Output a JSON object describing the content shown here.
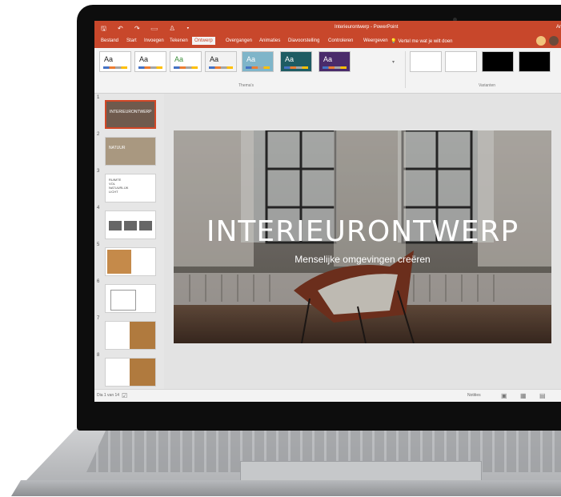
{
  "window": {
    "title": "Interieurontwerp - PowerPoint",
    "title_right": "Ar",
    "quick_access": "🖫 ↶ ↷ ▭ ♙ ▾"
  },
  "tabs": [
    {
      "label": "Bestand",
      "active": false
    },
    {
      "label": "Start",
      "active": false
    },
    {
      "label": "Invoegen",
      "active": false
    },
    {
      "label": "Tekenen",
      "active": false
    },
    {
      "label": "Ontwerp",
      "active": true
    },
    {
      "label": "Overgangen",
      "active": false
    },
    {
      "label": "Animaties",
      "active": false
    },
    {
      "label": "Diavoorstelling",
      "active": false
    },
    {
      "label": "Controleren",
      "active": false
    },
    {
      "label": "Weergeven",
      "active": false
    }
  ],
  "tell_me": {
    "text": "Vertel me wat je wilt doen",
    "icon": "lightbulb-icon"
  },
  "ribbon": {
    "themes": [
      {
        "label": "Aa",
        "bg": "#ffffff",
        "fg": "#222222"
      },
      {
        "label": "Aa",
        "bg": "#ffffff",
        "fg": "#222222"
      },
      {
        "label": "Aa",
        "bg": "#ffffff",
        "fg": "#3d8f3d"
      },
      {
        "label": "Aa",
        "bg": "#f2f2f2",
        "fg": "#222222"
      },
      {
        "label": "Aa",
        "bg": "#7fb5c9",
        "fg": "#ffffff"
      },
      {
        "label": "Aa",
        "bg": "#1f5c63",
        "fg": "#ffffff"
      },
      {
        "label": "Aa",
        "bg": "#4a2b6b",
        "fg": "#ffffff"
      }
    ],
    "themes_group_label": "Thema's",
    "variants": [
      {
        "bg": "#ffffff"
      },
      {
        "bg": "#ffffff"
      },
      {
        "bg": "#000000"
      },
      {
        "bg": "#000000"
      }
    ],
    "variants_group_label": "Varianten"
  },
  "slides": [
    {
      "num": "1",
      "text": "INTERIEURONTWERP",
      "bg": "#6f5a4d",
      "selected": true
    },
    {
      "num": "2",
      "text": "NATUUR",
      "bg": "#a99880",
      "selected": false
    },
    {
      "num": "3",
      "text": "RUIMTE VOL NATUURLIJK LICHT",
      "bg": "#ffffff",
      "selected": false
    },
    {
      "num": "4",
      "text": "",
      "bg": "#ffffff",
      "selected": false
    },
    {
      "num": "5",
      "text": "",
      "bg": "#ffffff",
      "selected": false
    },
    {
      "num": "6",
      "text": "",
      "bg": "#ffffff",
      "selected": false
    },
    {
      "num": "7",
      "text": "",
      "bg": "#b07a3e",
      "selected": false
    },
    {
      "num": "8",
      "text": "",
      "bg": "#b07a3e",
      "selected": false
    }
  ],
  "slide": {
    "title": "INTERIEURONTWERP",
    "subtitle": "Menselijke omgevingen creëren"
  },
  "status": {
    "slide_counter": "Dia 1 van 14",
    "notes": "Notities"
  },
  "colors": {
    "accent": "#c8472b",
    "selected_border": "#d24726"
  }
}
